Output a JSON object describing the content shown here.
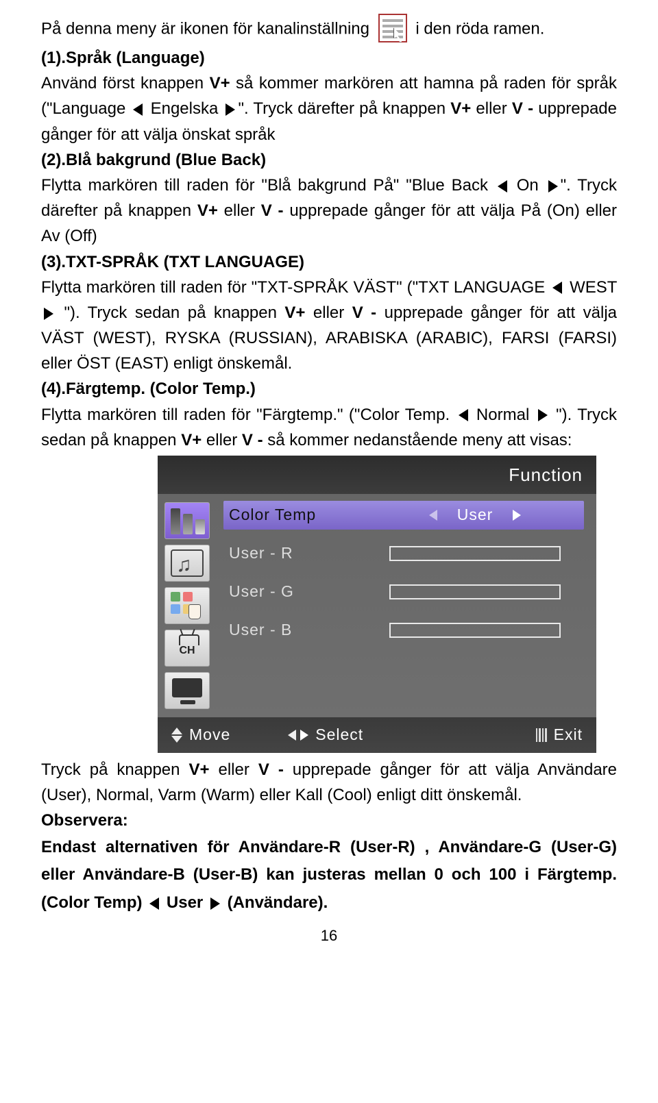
{
  "line1a": "På denna meny är ikonen för kanalinställning",
  "line1b": "i den röda ramen.",
  "h1": "(1).Språk (Language)",
  "p1a": "Använd först knappen ",
  "p1b": "V+",
  "p1c": " så kommer markören att hamna på raden för språk (\"Language ",
  "p1d": " Engelska ",
  "p1e": "\". Tryck därefter på knappen ",
  "p1f": "V+",
  "p1g": " eller ",
  "p1h": "V -",
  "p1i": " upprepade gånger för att välja önskat språk",
  "h2": "(2).Blå bakgrund (Blue Back)",
  "p2a": "Flytta markören till raden för \"Blå bakgrund På\" \"Blue Back ",
  "p2b": " On ",
  "p2c": "\". Tryck därefter på knappen ",
  "p2d": "V+",
  "p2e": " eller ",
  "p2f": "V -",
  "p2g": " upprepade gånger för att välja På (On) eller Av (Off)",
  "h3": "(3).TXT-SPRÅK (TXT LANGUAGE)",
  "p3a": "Flytta markören till raden för  \"TXT-SPRÅK VÄST\" (\"TXT LANGUAGE ",
  "p3b": " WEST ",
  "p3c": " \"). Tryck sedan på knappen ",
  "p3d": "V+",
  "p3e": " eller ",
  "p3f": "V -",
  "p3g": " upprepade gånger för att välja VÄST (WEST), RYSKA (RUSSIAN), ARABISKA (ARABIC), FARSI (FARSI) eller ÖST (EAST) enligt önskemål.",
  "h4": "(4).Färgtemp. (Color Temp.)",
  "p4a": "Flytta markören till raden för \"Färgtemp.\" (\"Color Temp. ",
  "p4b": " Normal ",
  "p4c": " \"). Tryck sedan på knappen ",
  "p4d": "V+",
  "p4e": " eller ",
  "p4f": "V -",
  "p4g": " så kommer nedanstående meny att visas:",
  "osd": {
    "title": "Function",
    "rows": {
      "r0": {
        "label": "Color Temp",
        "value": "User"
      },
      "r1": {
        "label": "User  -  R"
      },
      "r2": {
        "label": "User  -  G"
      },
      "r3": {
        "label": "User  -  B"
      }
    },
    "footer": {
      "move": "Move",
      "select": "Select",
      "exit": "Exit"
    }
  },
  "p5a": "Tryck på knappen ",
  "p5b": "V+",
  "p5c": " eller ",
  "p5d": "V -",
  "p5e": " upprepade gånger för att välja Användare (User), Normal, Varm (Warm) eller Kall (Cool) enligt ditt önskemål.",
  "obs": "Observera:",
  "p6a": "Endast alternativen för Användare-R (User-R)",
  "p6b": " , ",
  "p6c": "Användare-G (User-G) eller Användare-B (User-B) kan justeras mellan 0 och 100 i Färgtemp. (Color Temp) ",
  "p6d": " User ",
  "p6e": " (Användare).",
  "page": "16"
}
